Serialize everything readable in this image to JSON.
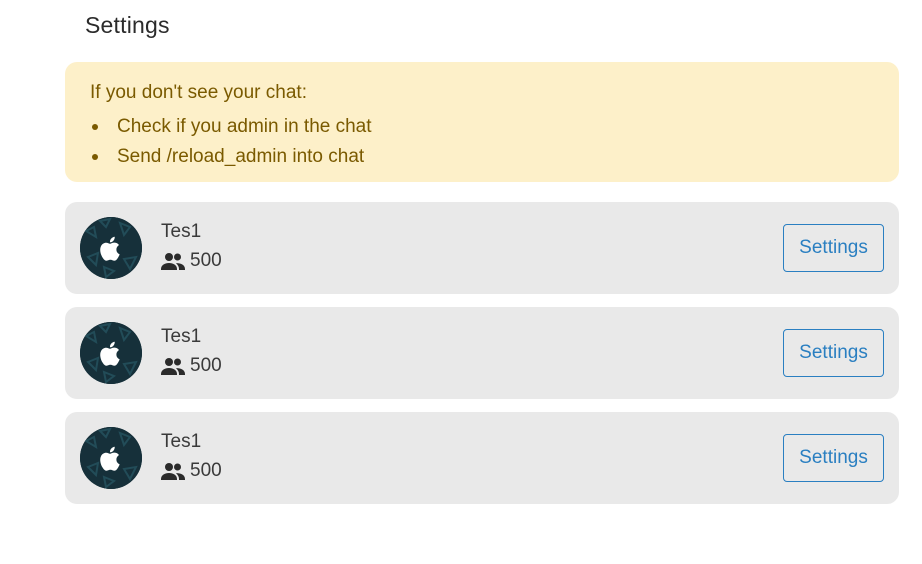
{
  "page": {
    "title": "Settings"
  },
  "notice": {
    "heading": "If you don't see your chat:",
    "items": [
      "Check if you admin in the chat",
      "Send /reload_admin into chat"
    ]
  },
  "chats": [
    {
      "name": "Tes1",
      "members": "500",
      "avatar_icon": "apple-logo-icon",
      "button_label": "Settings"
    },
    {
      "name": "Tes1",
      "members": "500",
      "avatar_icon": "apple-logo-icon",
      "button_label": "Settings"
    },
    {
      "name": "Tes1",
      "members": "500",
      "avatar_icon": "apple-logo-icon",
      "button_label": "Settings"
    }
  ],
  "colors": {
    "notice_background": "#fdf0c9",
    "notice_text": "#7a5a00",
    "card_background": "#e9e9e9",
    "accent": "#2a7fc1",
    "avatar_background": "#16303a"
  }
}
